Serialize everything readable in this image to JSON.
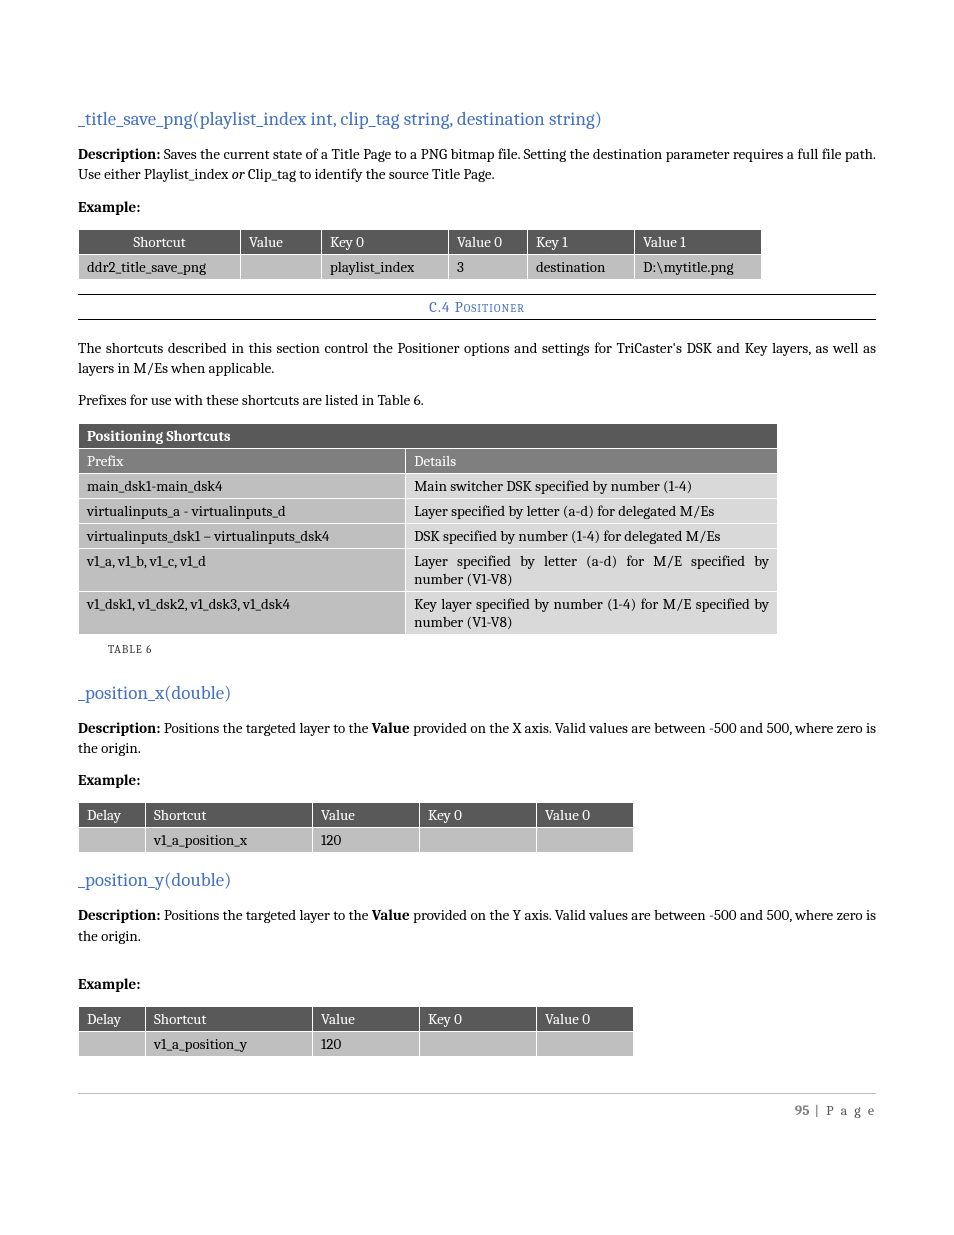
{
  "section1": {
    "heading": "_title_save_png(playlist_index int, clip_tag string, destination string)",
    "desc_label": "Description:",
    "desc_a": " Saves the current state of a Title Page to a PNG bitmap file. Setting the destination parameter requires a full file path.  Use either Playlist_index ",
    "or": "or",
    "desc_b": " Clip_tag to identify the source Title Page.",
    "example_label": "Example:",
    "table_headers": [
      "Shortcut",
      "Value",
      "Key 0",
      "Value 0",
      "Key 1",
      "Value 1"
    ],
    "table_row": [
      "ddr2_title_save_png",
      "",
      "playlist_index",
      "3",
      "destination",
      "D:\\mytitle.png"
    ]
  },
  "section_label": "C.4 Positioner",
  "positioner": {
    "p1": "The shortcuts described in this section control the Positioner options and settings for TriCaster's DSK and Key layers, as well as layers in M/Es when applicable.",
    "p2": "Prefixes for use with these shortcuts are listed in Table 6.",
    "table_title": "Positioning Shortcuts",
    "sub_headers": [
      "Prefix",
      "Details"
    ],
    "rows": [
      {
        "p": "main_dsk1-main_dsk4",
        "d": "Main switcher DSK specified by number (1-4)"
      },
      {
        "p": "virtualinputs_a - virtualinputs_d",
        "d": "Layer specified by letter (a-d)  for delegated M/Es"
      },
      {
        "p": "virtualinputs_dsk1 – virtualinputs_dsk4",
        "d": "DSK specified by number (1-4) for delegated M/Es"
      },
      {
        "p": "v1_a, v1_b, v1_c, v1_d",
        "d": "Layer specified by letter (a-d)  for M/E specified by number (V1-V8)"
      },
      {
        "p": "v1_dsk1, v1_dsk2, v1_dsk3, v1_dsk4",
        "d": "Key layer specified by number (1-4)  for M/E specified by number (V1-V8)"
      }
    ],
    "caption": "TABLE 6"
  },
  "posx": {
    "heading": "_position_x(double)",
    "desc_label": "Description:",
    "desc_a": "  Positions the targeted layer to the ",
    "val": "Value",
    "desc_b": " provided on the X axis. Valid values are between -500 and 500, where zero is the origin.",
    "example_label": "Example:",
    "headers": [
      "Delay",
      "Shortcut",
      "Value",
      "Key 0",
      "Value 0"
    ],
    "row": [
      "",
      "v1_a_position_x",
      "120",
      "",
      ""
    ]
  },
  "posy": {
    "heading": "_position_y(double)",
    "desc_label": "Description:",
    "desc_a": "  Positions the targeted layer to the ",
    "val": "Value",
    "desc_b": " provided on the Y axis. Valid values are between -500 and 500, where zero is the origin.",
    "example_label": "Example:",
    "headers": [
      "Delay",
      "Shortcut",
      "Value",
      "Key 0",
      "Value 0"
    ],
    "row": [
      "",
      "v1_a_position_y",
      "120",
      "",
      ""
    ]
  },
  "footer": {
    "num": "95",
    "sep": " | ",
    "word": "P a g e"
  },
  "chart_data": {
    "type": "table",
    "caption": "TABLE 6",
    "columns": [
      "Prefix",
      "Details"
    ],
    "rows": [
      [
        "main_dsk1-main_dsk4",
        "Main switcher DSK specified by number (1-4)"
      ],
      [
        "virtualinputs_a - virtualinputs_d",
        "Layer specified by letter (a-d) for delegated M/Es"
      ],
      [
        "virtualinputs_dsk1 – virtualinputs_dsk4",
        "DSK specified by number (1-4) for delegated M/Es"
      ],
      [
        "v1_a, v1_b, v1_c, v1_d",
        "Layer specified by letter (a-d) for M/E specified by number (V1-V8)"
      ],
      [
        "v1_dsk1, v1_dsk2, v1_dsk3, v1_dsk4",
        "Key layer specified by number (1-4) for M/E specified by number (V1-V8)"
      ]
    ]
  }
}
